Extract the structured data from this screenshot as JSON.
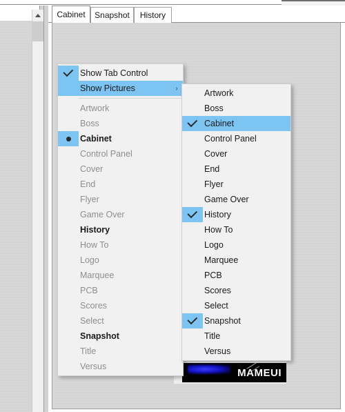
{
  "window": {
    "tabs": [
      {
        "label": "Cabinet",
        "active": true
      },
      {
        "label": "Snapshot",
        "active": false
      },
      {
        "label": "History",
        "active": false
      }
    ]
  },
  "banner": {
    "wordmark": "MAMEUI"
  },
  "scrollbar": {
    "up_arrow_icon": "chevron-up-icon"
  },
  "context_menu": {
    "items": [
      {
        "label": "Show Tab Control",
        "marker": "check",
        "state": "plain",
        "highlight": false,
        "submenu": false
      },
      {
        "label": "Show Pictures",
        "marker": "none",
        "state": "plain",
        "highlight": true,
        "submenu": true,
        "arrow": "›"
      },
      {
        "separator": true
      },
      {
        "label": "Artwork",
        "marker": "none",
        "state": "dim",
        "highlight": false,
        "submenu": false
      },
      {
        "label": "Boss",
        "marker": "none",
        "state": "dim",
        "highlight": false,
        "submenu": false
      },
      {
        "label": "Cabinet",
        "marker": "radio",
        "state": "bold",
        "highlight": false,
        "submenu": false
      },
      {
        "label": "Control Panel",
        "marker": "none",
        "state": "dim",
        "highlight": false,
        "submenu": false
      },
      {
        "label": "Cover",
        "marker": "none",
        "state": "dim",
        "highlight": false,
        "submenu": false
      },
      {
        "label": "End",
        "marker": "none",
        "state": "dim",
        "highlight": false,
        "submenu": false
      },
      {
        "label": "Flyer",
        "marker": "none",
        "state": "dim",
        "highlight": false,
        "submenu": false
      },
      {
        "label": "Game Over",
        "marker": "none",
        "state": "dim",
        "highlight": false,
        "submenu": false
      },
      {
        "label": "History",
        "marker": "none",
        "state": "bold",
        "highlight": false,
        "submenu": false
      },
      {
        "label": "How To",
        "marker": "none",
        "state": "dim",
        "highlight": false,
        "submenu": false
      },
      {
        "label": "Logo",
        "marker": "none",
        "state": "dim",
        "highlight": false,
        "submenu": false
      },
      {
        "label": "Marquee",
        "marker": "none",
        "state": "dim",
        "highlight": false,
        "submenu": false
      },
      {
        "label": "PCB",
        "marker": "none",
        "state": "dim",
        "highlight": false,
        "submenu": false
      },
      {
        "label": "Scores",
        "marker": "none",
        "state": "dim",
        "highlight": false,
        "submenu": false
      },
      {
        "label": "Select",
        "marker": "none",
        "state": "dim",
        "highlight": false,
        "submenu": false
      },
      {
        "label": "Snapshot",
        "marker": "none",
        "state": "bold",
        "highlight": false,
        "submenu": false
      },
      {
        "label": "Title",
        "marker": "none",
        "state": "dim",
        "highlight": false,
        "submenu": false
      },
      {
        "label": "Versus",
        "marker": "none",
        "state": "dim",
        "highlight": false,
        "submenu": false
      }
    ]
  },
  "submenu": {
    "items": [
      {
        "label": "Artwork",
        "marker": "none",
        "state": "plain",
        "highlight": false
      },
      {
        "label": "Boss",
        "marker": "none",
        "state": "plain",
        "highlight": false
      },
      {
        "label": "Cabinet",
        "marker": "check",
        "state": "plain",
        "highlight": true
      },
      {
        "label": "Control Panel",
        "marker": "none",
        "state": "plain",
        "highlight": false
      },
      {
        "label": "Cover",
        "marker": "none",
        "state": "plain",
        "highlight": false
      },
      {
        "label": "End",
        "marker": "none",
        "state": "plain",
        "highlight": false
      },
      {
        "label": "Flyer",
        "marker": "none",
        "state": "plain",
        "highlight": false
      },
      {
        "label": "Game Over",
        "marker": "none",
        "state": "plain",
        "highlight": false
      },
      {
        "label": "History",
        "marker": "check",
        "state": "plain",
        "highlight": false
      },
      {
        "label": "How To",
        "marker": "none",
        "state": "plain",
        "highlight": false
      },
      {
        "label": "Logo",
        "marker": "none",
        "state": "plain",
        "highlight": false
      },
      {
        "label": "Marquee",
        "marker": "none",
        "state": "plain",
        "highlight": false
      },
      {
        "label": "PCB",
        "marker": "none",
        "state": "plain",
        "highlight": false
      },
      {
        "label": "Scores",
        "marker": "none",
        "state": "plain",
        "highlight": false
      },
      {
        "label": "Select",
        "marker": "none",
        "state": "plain",
        "highlight": false
      },
      {
        "label": "Snapshot",
        "marker": "check",
        "state": "plain",
        "highlight": false
      },
      {
        "label": "Title",
        "marker": "none",
        "state": "plain",
        "highlight": false
      },
      {
        "label": "Versus",
        "marker": "none",
        "state": "plain",
        "highlight": false
      }
    ]
  },
  "colors": {
    "highlight": "#7cc4f2",
    "menu_bg": "#f1f1f1",
    "text": "#2b2b2b",
    "text_dim": "#8e8e8e"
  }
}
